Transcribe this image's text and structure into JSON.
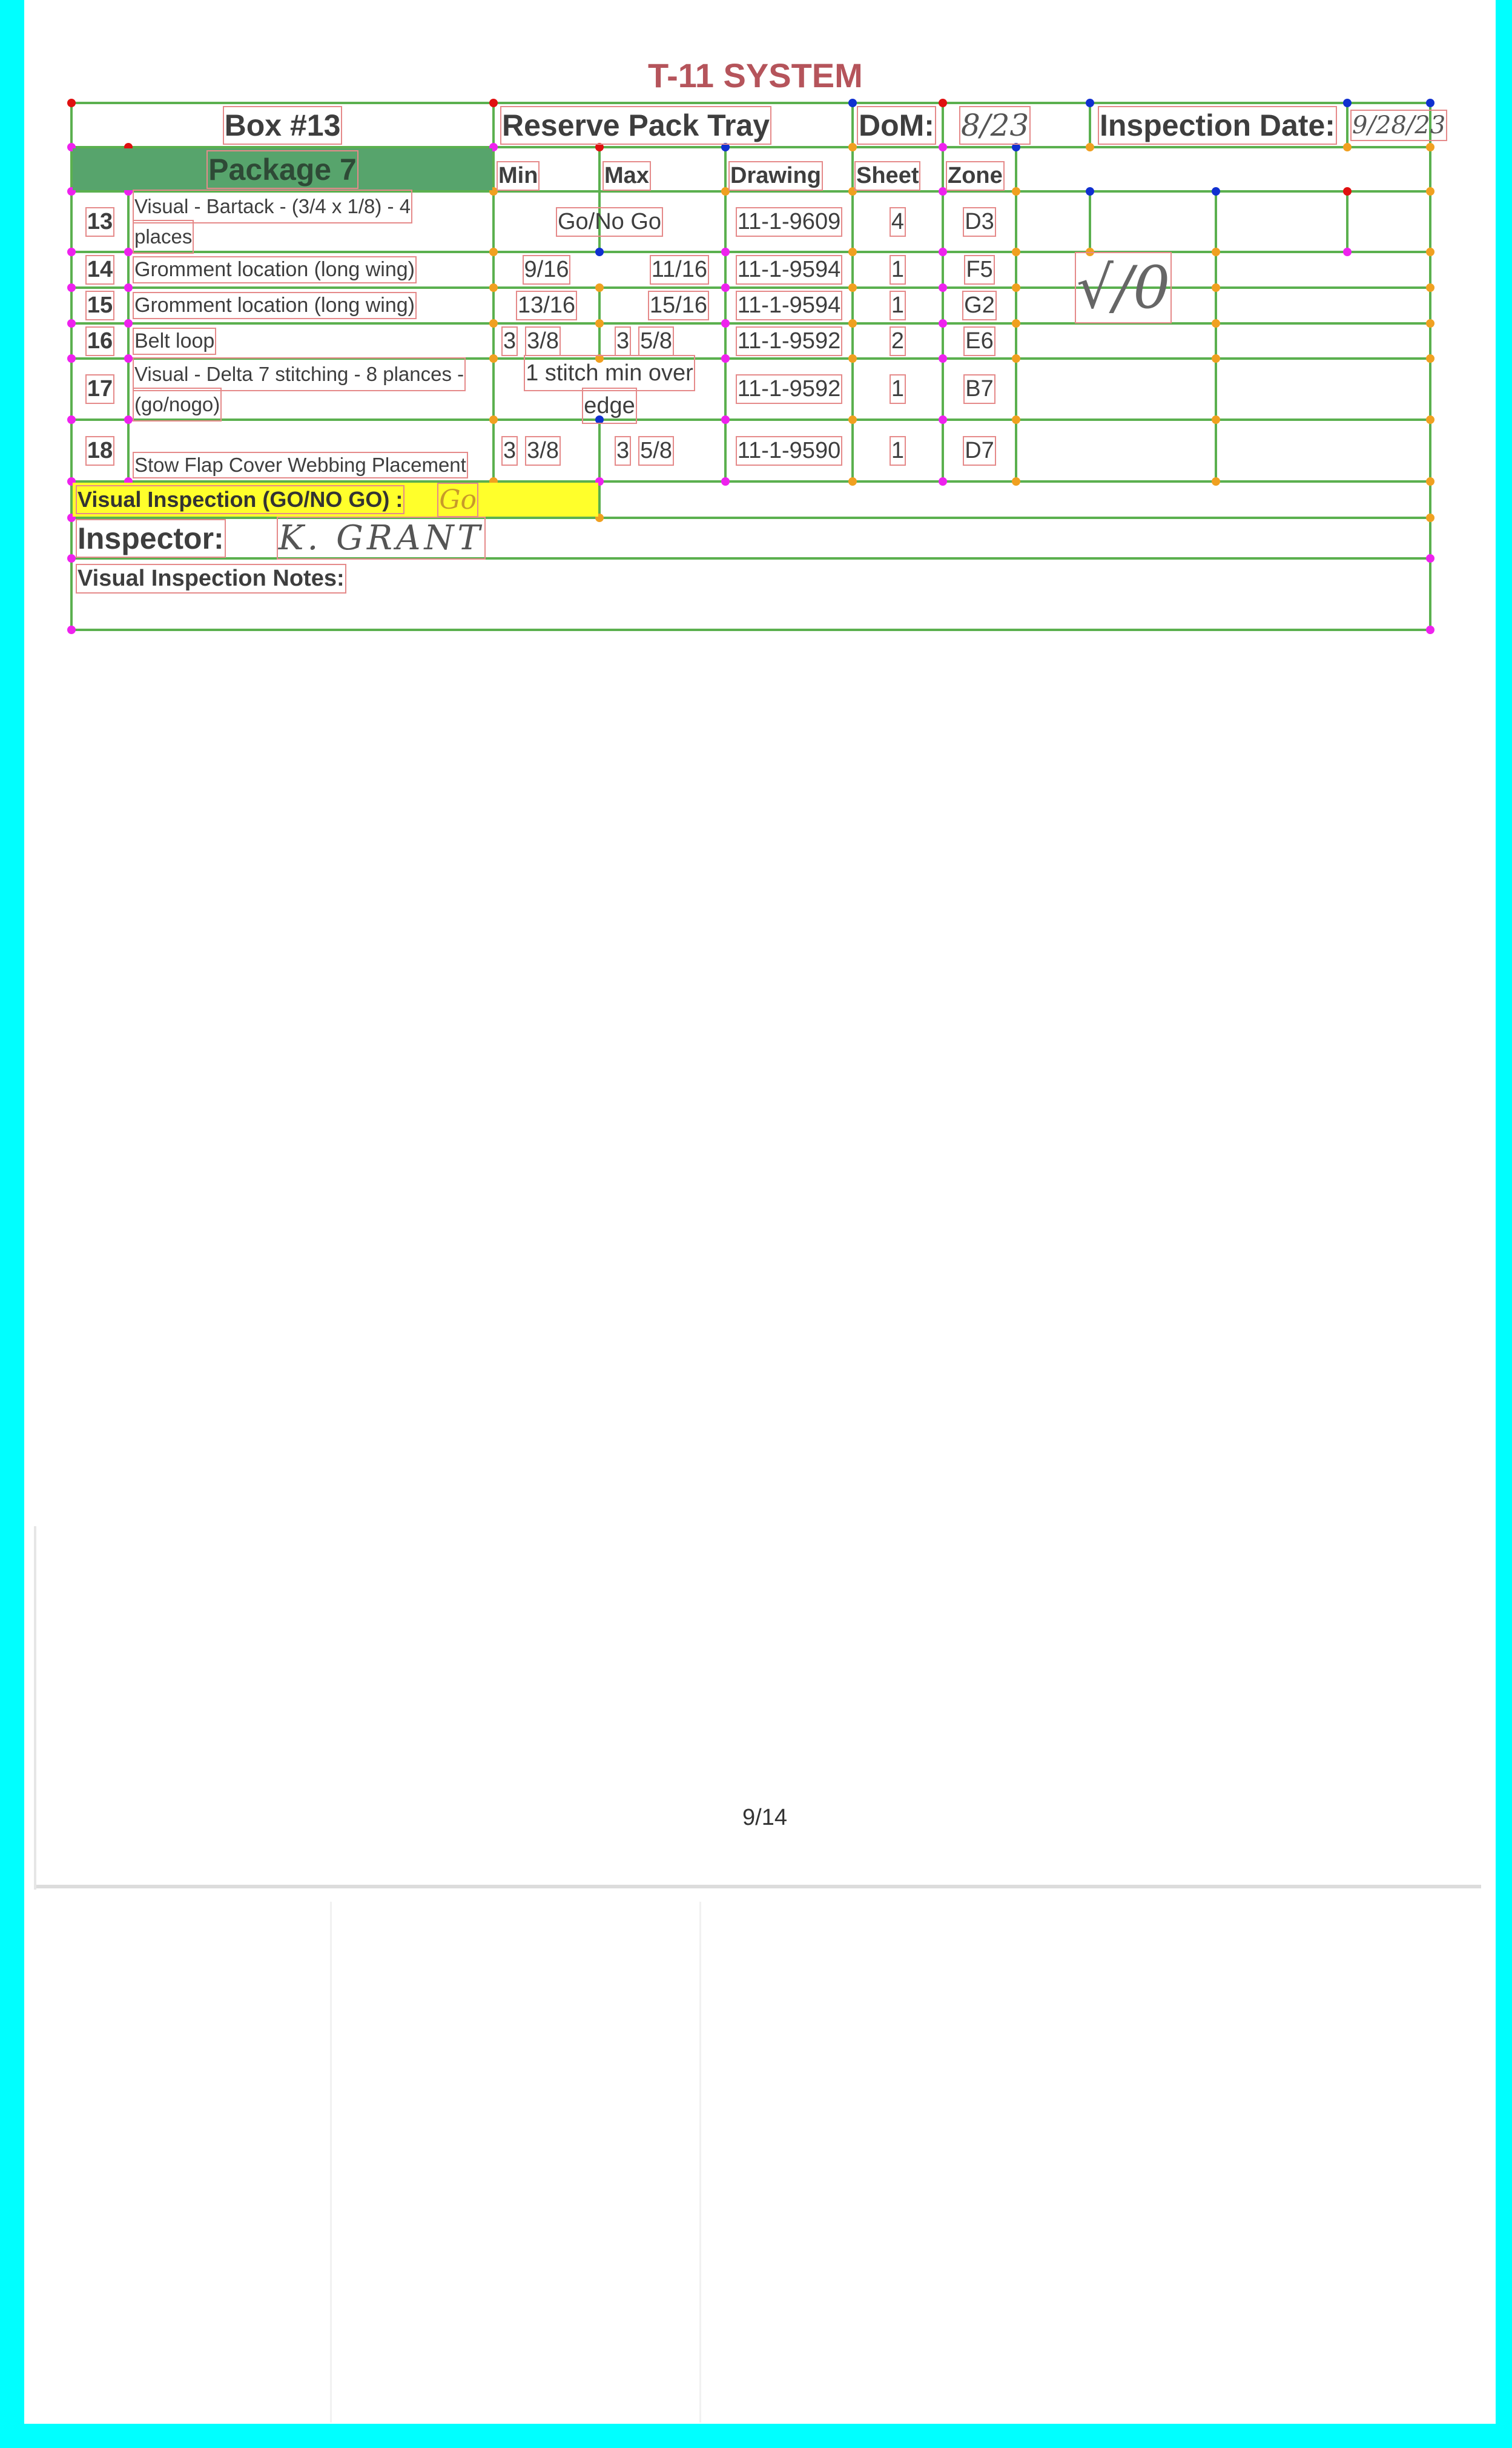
{
  "title": "T-11 SYSTEM",
  "header": {
    "box": "Box #13",
    "item": "Reserve Pack Tray",
    "dom_label": "DoM:",
    "dom_value": "8/23",
    "inspection_date_label": "Inspection Date:",
    "inspection_date_value": "9/28/23"
  },
  "columns": {
    "package": "Package 7",
    "min": "Min",
    "max": "Max",
    "drawing": "Drawing",
    "sheet": "Sheet",
    "zone": "Zone"
  },
  "rows": [
    {
      "num": "13",
      "desc": [
        "Visual - Bartack - (3/4 x 1/8) - 4",
        "places"
      ],
      "range": "Go/No Go",
      "drawing": "11-1-9609",
      "sheet": "4",
      "zone": "D3"
    },
    {
      "num": "14",
      "desc": [
        "Gromment location (long wing)"
      ],
      "min": "9/16",
      "max": "11/16",
      "drawing": "11-1-9594",
      "sheet": "1",
      "zone": "F5"
    },
    {
      "num": "15",
      "desc": [
        "Gromment location (long wing)"
      ],
      "min": "13/16",
      "max": "15/16",
      "drawing": "11-1-9594",
      "sheet": "1",
      "zone": "G2"
    },
    {
      "num": "16",
      "desc": [
        "Belt loop"
      ],
      "min_whole": "3",
      "min_frac": "3/8",
      "max_whole": "3",
      "max_frac": "5/8",
      "drawing": "11-1-9592",
      "sheet": "2",
      "zone": "E6"
    },
    {
      "num": "17",
      "desc": [
        "Visual - Delta 7 stitching - 8 plances -",
        "(go/nogo)"
      ],
      "range": [
        "1 stitch min over",
        "edge"
      ],
      "drawing": "11-1-9592",
      "sheet": "1",
      "zone": "B7"
    },
    {
      "num": "18",
      "desc": [
        "Stow Flap Cover Webbing Placement"
      ],
      "min_whole": "3",
      "min_frac": "3/8",
      "max_whole": "3",
      "max_frac": "5/8",
      "drawing": "11-1-9590",
      "sheet": "1",
      "zone": "D7"
    }
  ],
  "handwritten_mark": "√/0",
  "visual_inspection_label": "Visual Inspection (GO/NO GO) :",
  "visual_inspection_value": "Go",
  "inspector_label": "Inspector:",
  "inspector_value": "K. GRANT",
  "notes_label": "Visual Inspection Notes:",
  "page_number": "9/14",
  "colors": {
    "title": "#b5545b",
    "grid_line": "#5bb04f",
    "package_fill": "#57a46c",
    "highlight": "#ffff2b",
    "text_outline": "#e58a8a",
    "frame": "#00ffff"
  }
}
